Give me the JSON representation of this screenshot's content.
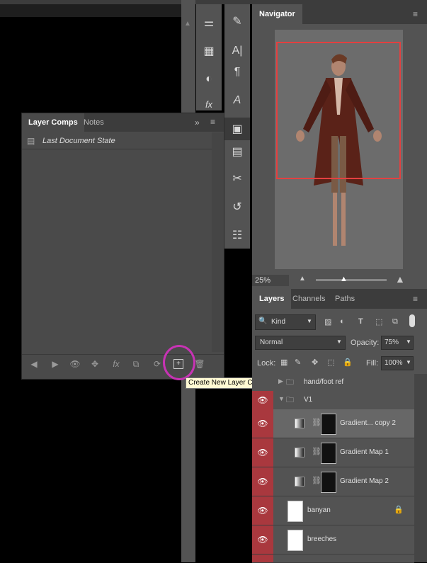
{
  "layer_comps": {
    "tabs": [
      "Layer Comps",
      "Notes"
    ],
    "items": [
      "Last Document State"
    ],
    "tooltip": "Create New Layer Comp"
  },
  "navigator": {
    "title": "Navigator",
    "zoom": "25%"
  },
  "layers": {
    "tabs": [
      "Layers",
      "Channels",
      "Paths"
    ],
    "filter_kind": "Kind",
    "blend_mode": "Normal",
    "opacity_label": "Opacity:",
    "opacity_value": "75%",
    "lock_label": "Lock:",
    "fill_label": "Fill:",
    "fill_value": "100%",
    "rows": [
      {
        "name": "hand/foot ref"
      },
      {
        "name": "V1"
      },
      {
        "name": "Gradient... copy 2"
      },
      {
        "name": "Gradient Map 1"
      },
      {
        "name": "Gradient Map 2"
      },
      {
        "name": "banyan"
      },
      {
        "name": "breeches"
      }
    ]
  }
}
